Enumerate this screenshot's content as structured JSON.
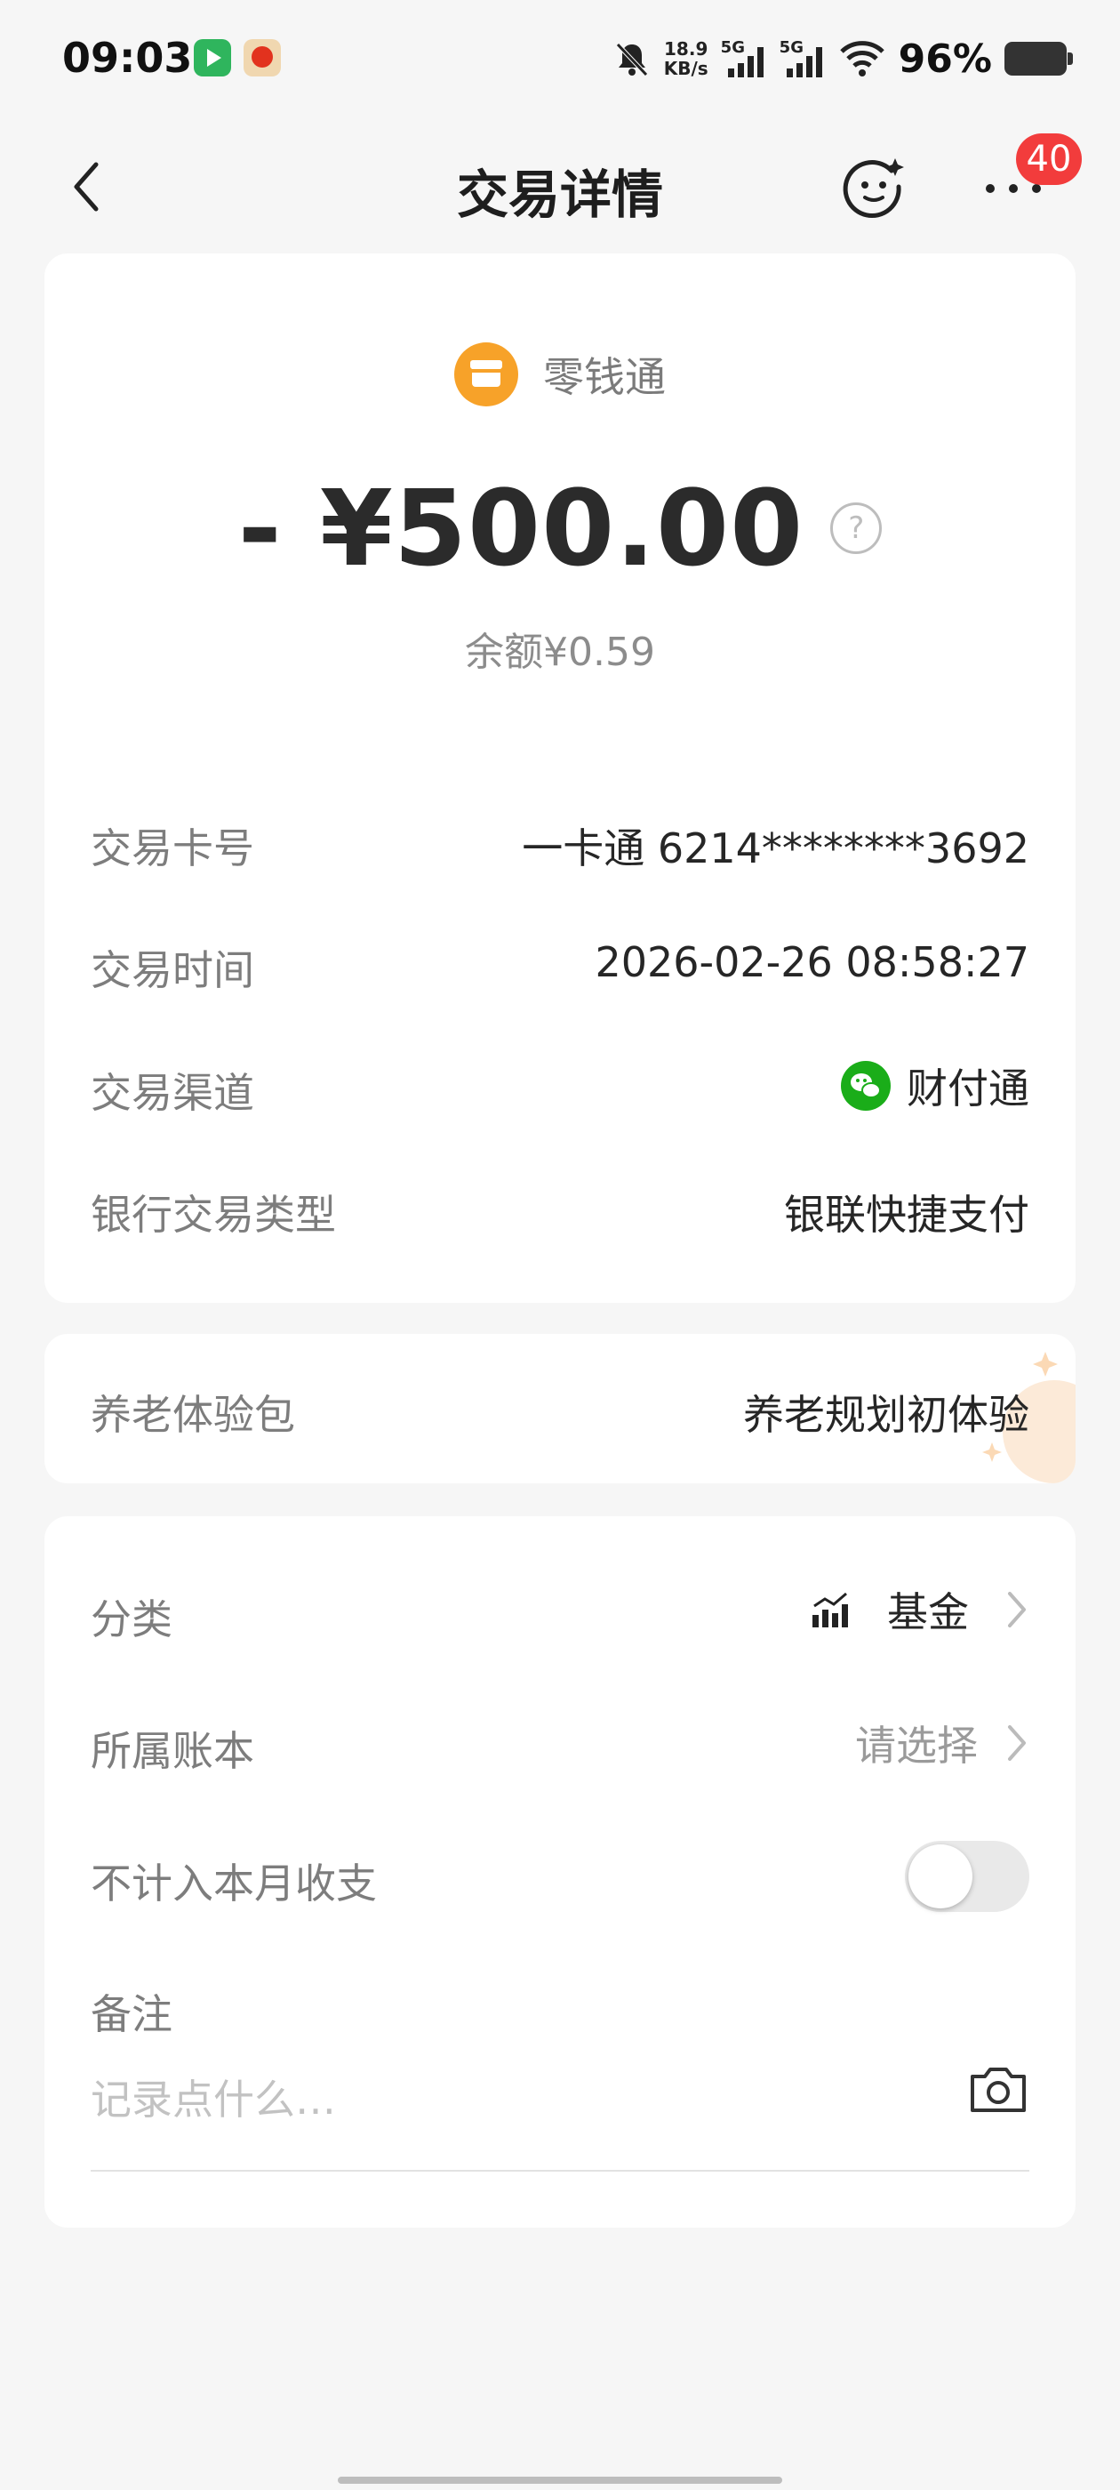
{
  "status_bar": {
    "time": "09:03",
    "net_speed_value": "18.9",
    "net_speed_unit": "KB/s",
    "signal_1": "5G",
    "signal_2": "5G",
    "battery": "96%"
  },
  "header": {
    "title": "交易详情",
    "badge": "40"
  },
  "summary": {
    "merchant": "零钱通",
    "amount": "- ¥500.00",
    "balance": "余额¥0.59"
  },
  "details": [
    {
      "label": "交易卡号",
      "value": "一卡通 6214********3692"
    },
    {
      "label": "交易时间",
      "value": "2026-02-26 08:58:27"
    },
    {
      "label": "交易渠道",
      "value": "财付通"
    },
    {
      "label": "银行交易类型",
      "value": "银联快捷支付"
    }
  ],
  "pension": {
    "label": "养老体验包",
    "value": "养老规划初体验"
  },
  "settings": {
    "category_label": "分类",
    "category_value": "基金",
    "ledger_label": "所属账本",
    "ledger_value": "请选择",
    "exclude_label": "不计入本月收支",
    "exclude_on": false,
    "note_label": "备注",
    "note_placeholder": "记录点什么…"
  },
  "colors": {
    "accent_orange": "#f7a229",
    "badge_red": "#f23c3c",
    "wechat_green": "#1aad19"
  }
}
